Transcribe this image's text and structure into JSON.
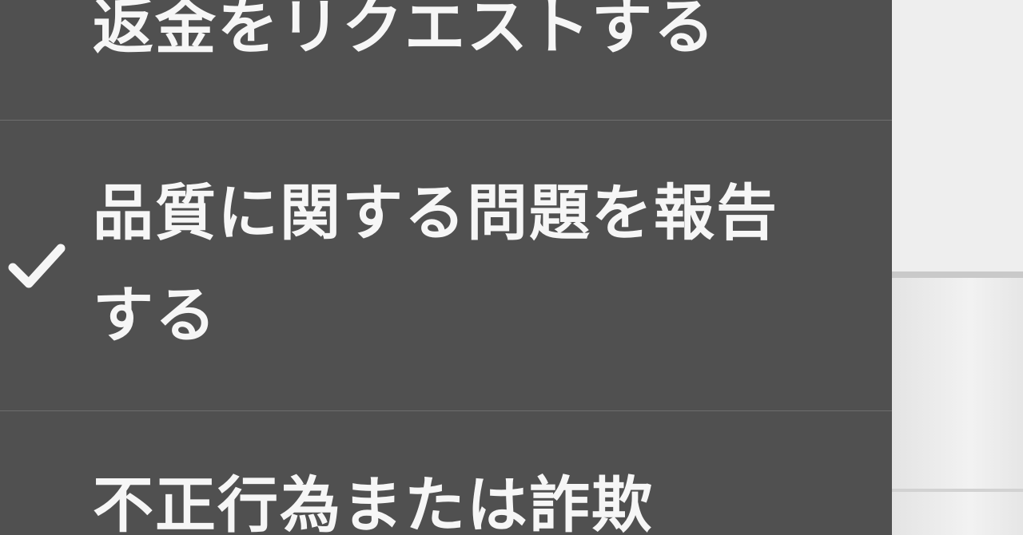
{
  "menu": {
    "items": [
      {
        "label": "返金をリクエストする",
        "selected": false
      },
      {
        "label": "品質に関する問題を報告する",
        "selected": true
      },
      {
        "label": "不正行為または詐欺",
        "selected": false
      }
    ],
    "check_icon": "checkmark-icon",
    "colors": {
      "menu_background": "#505050",
      "text": "#f6f6f6",
      "separator": "#6e6e6e",
      "backdrop": "#ececec"
    }
  }
}
